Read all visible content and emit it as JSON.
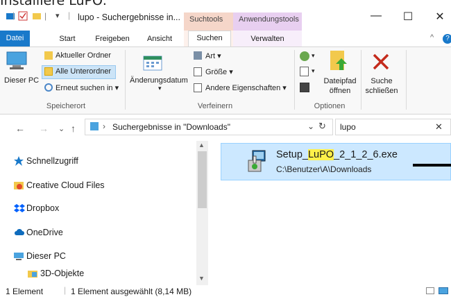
{
  "heading": "Installiere LuPO:",
  "window": {
    "title": "lupo - Suchergebnisse in...",
    "context_tabs": [
      "Suchtools",
      "Anwendungstools"
    ],
    "controls": [
      "—",
      "☐",
      "✕"
    ]
  },
  "ribbon_tabs": [
    "Datei",
    "Start",
    "Freigeben",
    "Ansicht",
    "Suchen",
    "Verwalten"
  ],
  "ribbon": {
    "speicherort": {
      "dieser_pc": "Dieser PC",
      "aktueller_ordner": "Aktueller Ordner",
      "alle_unterordner": "Alle Unterordner",
      "erneut_suchen": "Erneut suchen in",
      "label": "Speicherort"
    },
    "verfeinern": {
      "aenderungsdatum": "Änderungsdatum",
      "art": "Art",
      "groesse": "Größe",
      "andere": "Andere Eigenschaften",
      "label": "Verfeinern"
    },
    "optionen": {
      "dateipfad": "Dateipfad",
      "oeffnen": "öffnen",
      "label": "Optionen"
    },
    "suche_schliessen": {
      "line1": "Suche",
      "line2": "schließen"
    }
  },
  "address": {
    "path": "Suchergebnisse in \"Downloads\"",
    "search_value": "lupo"
  },
  "nav_items": [
    {
      "label": "Schnellzugriff",
      "icon": "star-icon"
    },
    {
      "label": "Creative Cloud Files",
      "icon": "creative-cloud-icon"
    },
    {
      "label": "Dropbox",
      "icon": "dropbox-icon"
    },
    {
      "label": "OneDrive",
      "icon": "cloud-icon"
    },
    {
      "label": "Dieser PC",
      "icon": "pc-icon"
    },
    {
      "label": "3D-Objekte",
      "icon": "cube-folder-icon"
    }
  ],
  "result": {
    "name_pre": "Setup_",
    "name_hl": "LuPO",
    "name_post": "_2_1_2_6.exe",
    "path": "C:\\Benutzer\\A\\Downloads"
  },
  "status": {
    "count": "1 Element",
    "selected": "1 Element ausgewählt (8,14 MB)"
  },
  "colors": {
    "accent": "#1979ca",
    "selection": "#cce8ff",
    "highlight": "#fff14a",
    "close_red": "#c42b1c"
  }
}
